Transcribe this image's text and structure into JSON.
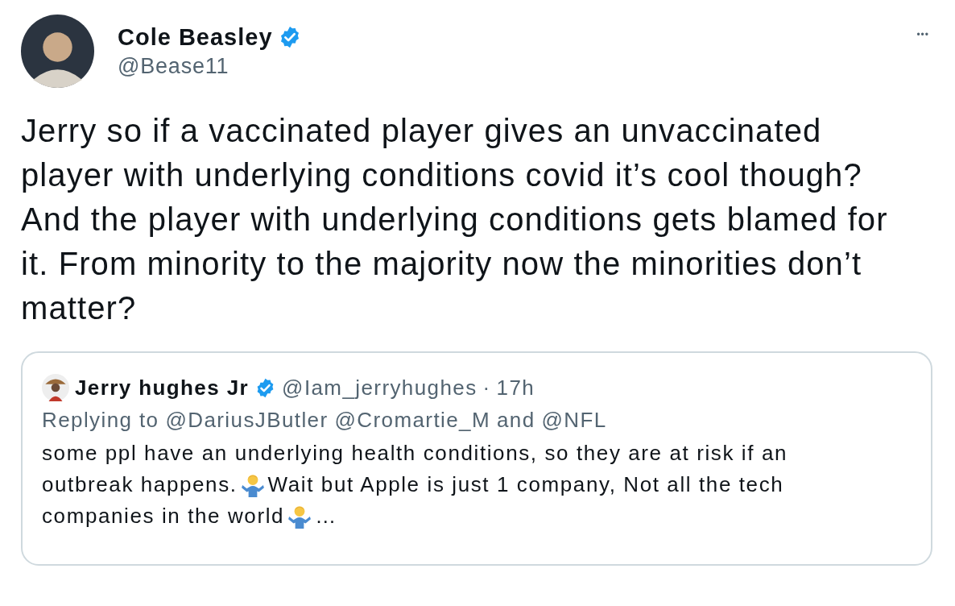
{
  "tweet": {
    "author": {
      "name": "Cole Beasley",
      "verified": true,
      "handle": "@Bease11"
    },
    "more": "•••",
    "text": "Jerry so if a vaccinated player gives an unvaccinated player with underlying conditions covid it’s cool though? And the player with underlying conditions gets blamed for it. From minority to the majority now the minorities don’t matter?",
    "quote": {
      "author": {
        "name": "Jerry hughes Jr",
        "verified": true,
        "handle": "@Iam_jerryhughes"
      },
      "separator": "·",
      "time": "17h",
      "replying": {
        "label": "Replying to",
        "mentions": [
          "@DariusJButler",
          "@Cromartie_M"
        ],
        "joiner": "and",
        "last": "@NFL"
      },
      "lines": [
        [
          {
            "kind": "text",
            "text": "some ppl have an underlying health conditions, so they are at risk if an"
          }
        ],
        [
          {
            "kind": "text",
            "text": "outbreak happens."
          },
          {
            "kind": "emoji"
          },
          {
            "kind": "text",
            "text": "Wait but Apple is just 1 company, Not all the tech"
          }
        ],
        [
          {
            "kind": "text",
            "text": "companies in the world"
          },
          {
            "kind": "emoji"
          },
          {
            "kind": "text",
            "text": "…"
          }
        ]
      ]
    }
  }
}
